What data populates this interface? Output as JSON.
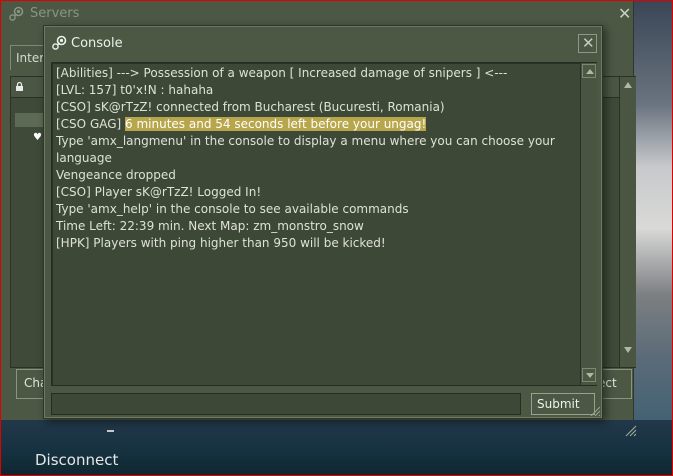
{
  "servers_window": {
    "title": "Servers",
    "tab_label": "Inter",
    "left_button_label": "Cha",
    "right_button_label": "ect"
  },
  "game": {
    "disconnect_label": "Disconnect"
  },
  "console": {
    "title": "Console",
    "lines": [
      {
        "text": "[Abilities] ---> Possession of a weapon [ Increased damage of snipers ] <---"
      },
      {
        "text": "[LVL: 157] t0'x!N : hahaha"
      },
      {
        "text": "[CSO] sK@rTzZ! connected from Bucharest (Bucuresti, Romania)"
      },
      {
        "prefix": "[CSO GAG] ",
        "highlight": "6 minutes and 54 seconds left before your ungag!"
      },
      {
        "text": "Type 'amx_langmenu' in the console to display a menu where you can choose your language"
      },
      {
        "text": "Vengeance dropped"
      },
      {
        "text": "[CSO] Player sK@rTzZ! Logged In!"
      },
      {
        "text": "Type 'amx_help' in the console to see available commands"
      },
      {
        "text": "Time Left: 22:39 min. Next Map: zm_monstro_snow"
      },
      {
        "text": "[HPK] Players with ping higher than 950 will be kicked!"
      }
    ],
    "input_value": "",
    "submit_label": "Submit"
  },
  "colors": {
    "panel": "#4c5844",
    "output_bg": "#3e4837",
    "highlight": "#b8a64a",
    "frame": "#e00000"
  },
  "icons": [
    "steam-logo-icon",
    "close-icon",
    "scroll-up-arrow-icon",
    "scroll-down-arrow-icon",
    "lock-icon",
    "heart-icon",
    "resize-grip-icon"
  ]
}
